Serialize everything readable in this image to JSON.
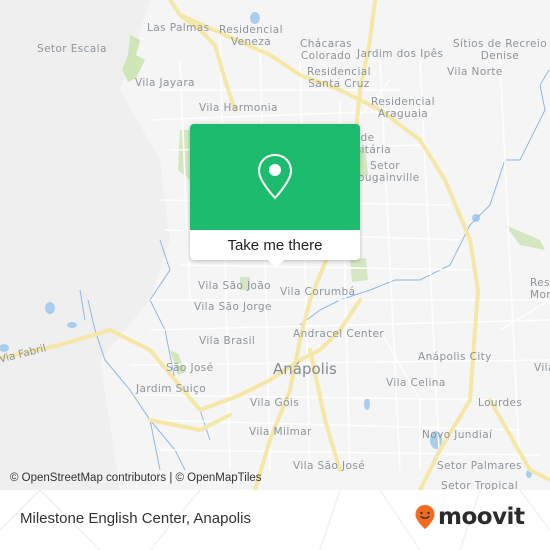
{
  "map": {
    "city_label": "Anápolis",
    "neighborhoods": [
      {
        "name": "Las Palmas"
      },
      {
        "name": "Residencial Veneza"
      },
      {
        "name": "Setor Escala"
      },
      {
        "name": "Chácaras Colorado"
      },
      {
        "name": "Jardim dos Ipês"
      },
      {
        "name": "Sítios de Recreio Denise"
      },
      {
        "name": "Residencial Santa Cruz"
      },
      {
        "name": "Vila Norte"
      },
      {
        "name": "Vila Jayara"
      },
      {
        "name": "Vila Harmonia"
      },
      {
        "name": "Residencial Araguaia"
      },
      {
        "name": "Cidade Universitária"
      },
      {
        "name": "Setor Bougainville"
      },
      {
        "name": "Vila São João"
      },
      {
        "name": "Vila Corumbá"
      },
      {
        "name": "Vila São Jorge"
      },
      {
        "name": "Andracel Center"
      },
      {
        "name": "Vila Brasil"
      },
      {
        "name": "Anápolis City"
      },
      {
        "name": "São José"
      },
      {
        "name": "Vila Celina"
      },
      {
        "name": "Jardim Suiço"
      },
      {
        "name": "Vila Góis"
      },
      {
        "name": "Lourdes"
      },
      {
        "name": "Vila Milmar"
      },
      {
        "name": "Novo Jundiaí"
      },
      {
        "name": "Vila São José"
      },
      {
        "name": "Setor Palmares"
      },
      {
        "name": "Setor Tropical"
      },
      {
        "name": "Res. Mor..."
      }
    ],
    "road_labels": [
      "Via Fabril"
    ],
    "popup": {
      "icon": "map-pin-icon",
      "button_label": "Take me there",
      "accent_color": "#1dbb6d"
    },
    "attribution": "© OpenStreetMap contributors | © OpenMapTiles"
  },
  "footer": {
    "place_name": "Milestone English Center, Anapolis",
    "brand": "moovit",
    "brand_color": "#f26b21"
  }
}
